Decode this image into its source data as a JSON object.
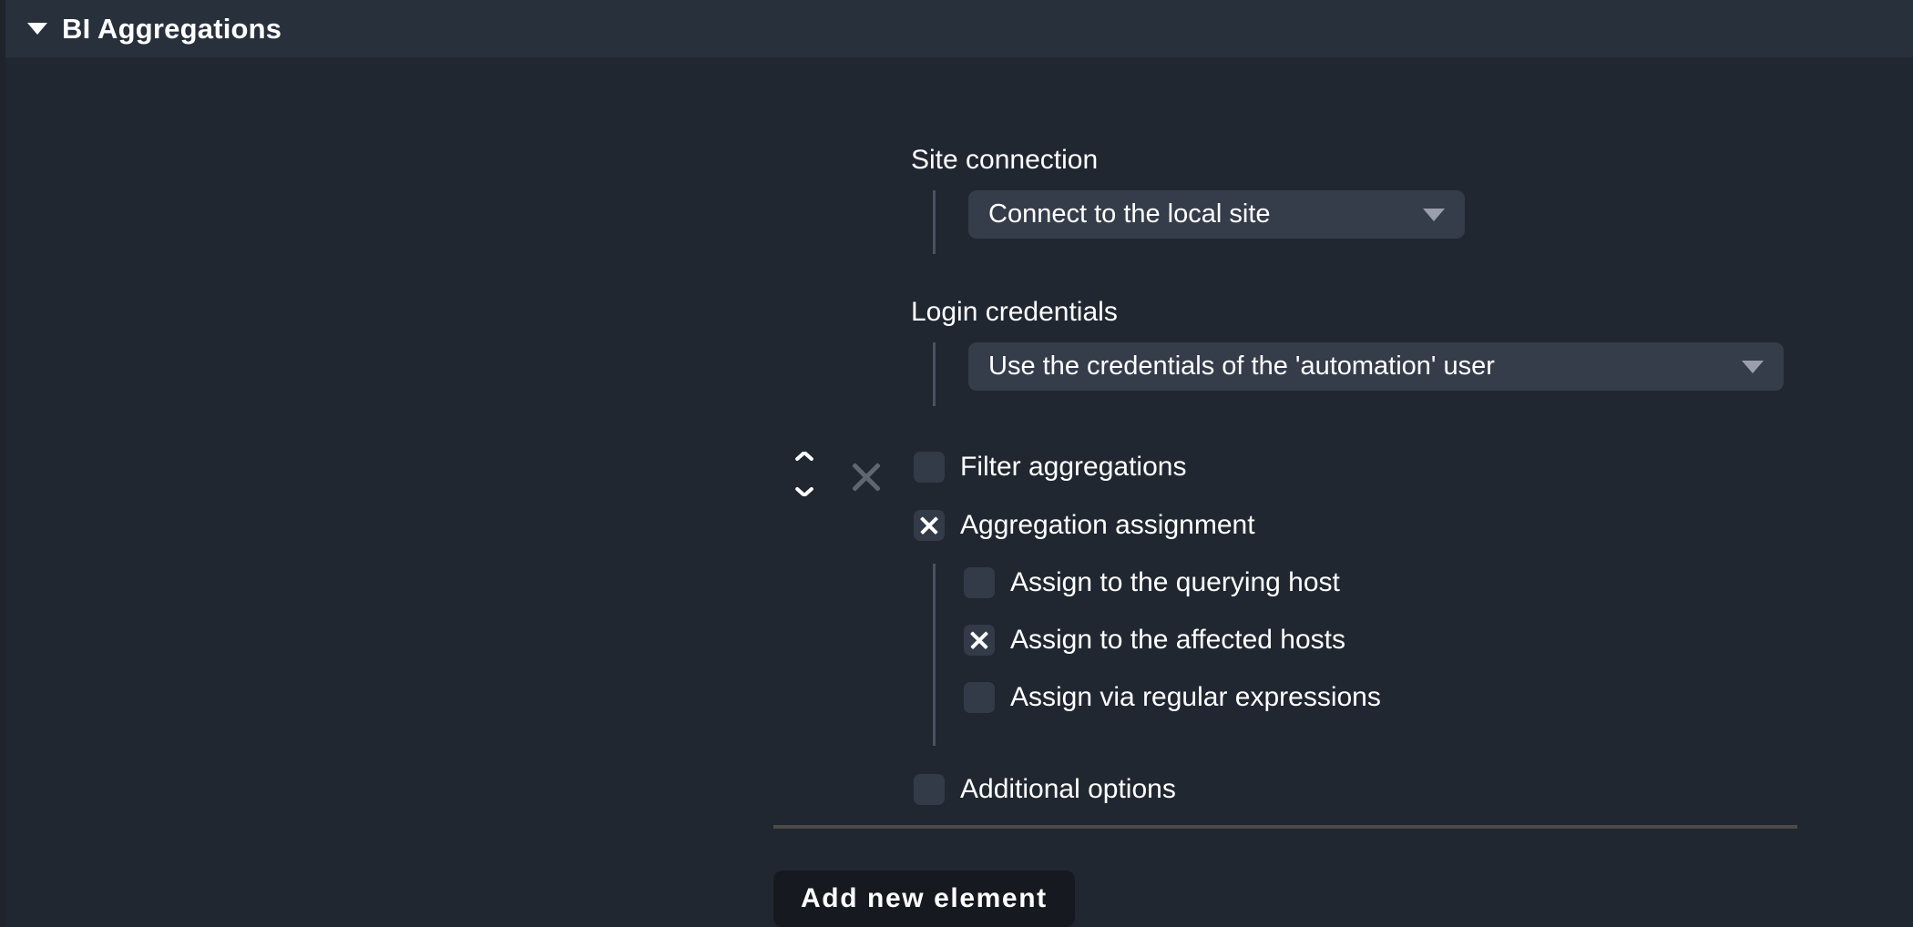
{
  "section": {
    "title": "BI Aggregations",
    "collapse_icon": "caret-down-icon",
    "expanded": true
  },
  "site_connection": {
    "label": "Site connection",
    "dropdown": {
      "value": "Connect to the local site",
      "caret_icon": "caret-down-icon"
    }
  },
  "login_credentials": {
    "label": "Login credentials",
    "dropdown": {
      "value": "Use the credentials of the 'automation' user",
      "caret_icon": "caret-down-icon"
    }
  },
  "row_controls": {
    "sort_up_icon": "chevron-up-icon",
    "sort_down_icon": "chevron-down-icon",
    "delete_icon": "close-x-icon"
  },
  "options": [
    {
      "label": "Filter aggregations",
      "checked": false
    },
    {
      "label": "Aggregation assignment",
      "checked": true
    }
  ],
  "assignment_options": [
    {
      "label": "Assign to the querying host",
      "checked": false
    },
    {
      "label": "Assign to the affected hosts",
      "checked": true
    },
    {
      "label": "Assign via regular expressions",
      "checked": false
    }
  ],
  "additional_options": {
    "label": "Additional options",
    "checked": false
  },
  "actions": {
    "add_new_element": "Add new element"
  },
  "colors": {
    "page_bg": "#212731",
    "header_bg": "#28303c",
    "edge_strip": "#1e232c",
    "control_bg": "#353c4a",
    "checkbox_bg": "#333a48",
    "indent_line": "#4a5160",
    "divider": "#4d4b45",
    "button_bg": "#16191f",
    "caret_gray": "#9aa0ab",
    "delete_gray": "#5f6672",
    "text": "#ffffff"
  }
}
